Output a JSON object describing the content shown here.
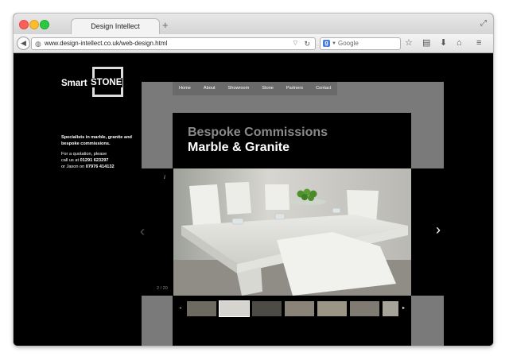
{
  "browser": {
    "tab_title": "Design Intellect",
    "new_tab": "+",
    "url": "www.design-intellect.co.uk/web-design.html",
    "search_placeholder": "Google",
    "search_engine_icon": "g-icon"
  },
  "site": {
    "logo_smart": "Smart",
    "logo_stone": "STONE",
    "nav": [
      "Home",
      "About",
      "Showroom",
      "Stone",
      "Partners",
      "Contact"
    ],
    "tagline": "Specialists in marble, granite and bespoke commissions.",
    "contact_line1": "For a quotation, please",
    "contact_line2_prefix": "call us at ",
    "contact_phone1": "01291 623297",
    "contact_line3_prefix": "or Jason on ",
    "contact_phone2": "07976 414132",
    "hero_title1": "Bespoke Commissions",
    "hero_title2": "Marble & Granite",
    "slide_counter": "2 / 20",
    "info_icon": "i"
  },
  "colors": {
    "page_bg": "#000000",
    "panel": "#7a7a7a",
    "nav_bg": "#6a6a6a",
    "title_gray": "#8a8a8a"
  }
}
